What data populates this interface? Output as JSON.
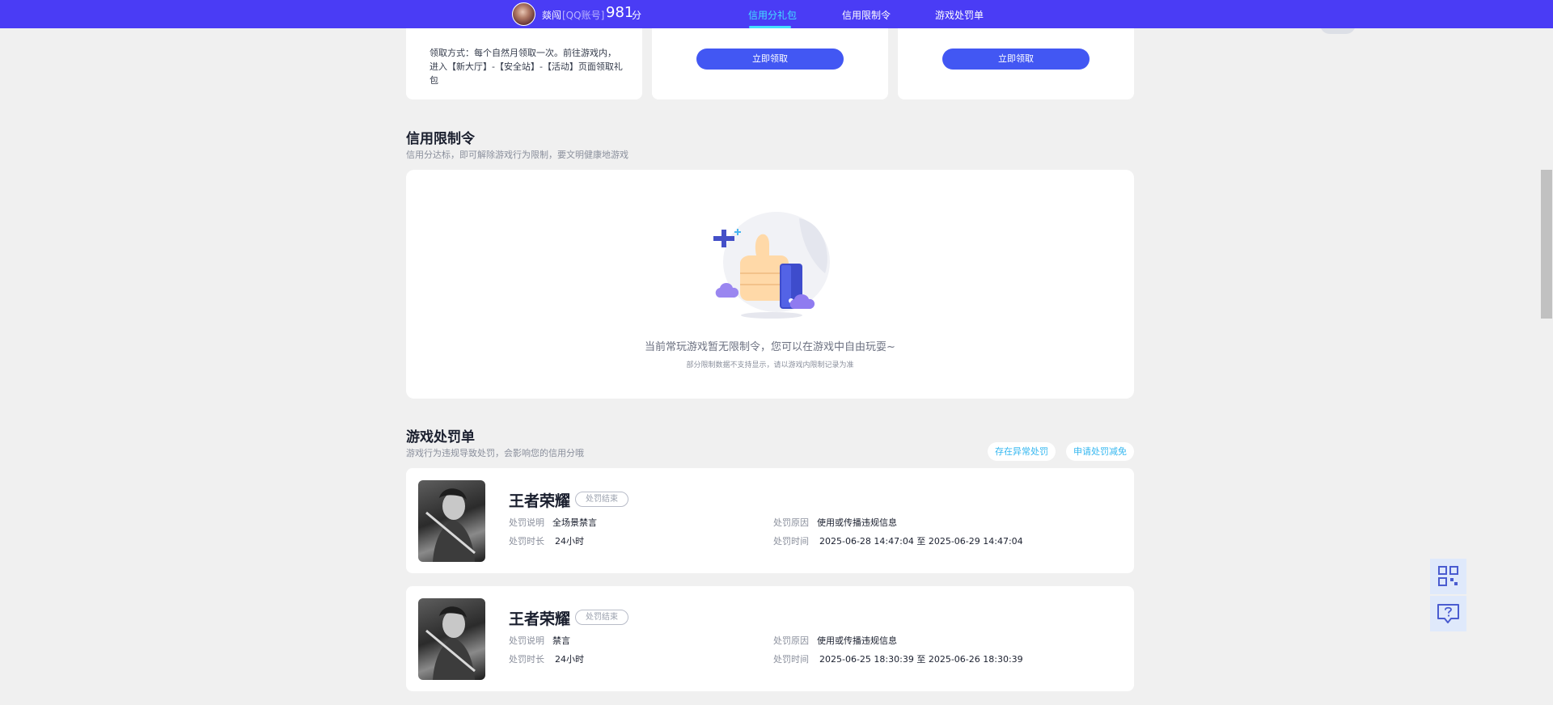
{
  "header": {
    "nickname": "燚闯",
    "account_type": "[QQ账号]",
    "credit_score": "981",
    "score_unit": "分",
    "tabs": [
      {
        "label": "信用分礼包",
        "active": true
      },
      {
        "label": "信用限制令",
        "active": false
      },
      {
        "label": "游戏处罚单",
        "active": false
      }
    ],
    "nav_color": "#4a3cf5",
    "active_tab_color": "#43e0ff"
  },
  "gift_section": {
    "card1_desc": "领取方式：每个自然月领取一次。前往游戏内，进入【新大厅】-【安全站】-【活动】页面领取礼包",
    "card2_button": "立即领取",
    "card3_button": "立即领取",
    "button_color": "#4257f3"
  },
  "restriction_section": {
    "title": "信用限制令",
    "subtitle": "信用分达标，即可解除游戏行为限制，要文明健康地游戏",
    "empty_text": "当前常玩游戏暂无限制令，您可以在游戏中自由玩耍~",
    "empty_note": "部分限制数据不支持显示，请以游戏内限制记录为准"
  },
  "punishment_section": {
    "title": "游戏处罚单",
    "subtitle": "游戏行为违规导致处罚，会影响您的信用分哦",
    "report_button": "存在异常处罚",
    "reduce_button": "申请处罚减免",
    "items": [
      {
        "game": "王者荣耀",
        "status": "处罚结束",
        "desc_label": "处罚说明",
        "desc": "全场景禁言",
        "reason_label": "处罚原因",
        "reason": "使用或传播违规信息",
        "duration_label": "处罚时长",
        "duration": "24小时",
        "time_label": "处罚时间",
        "time": "2025-06-28 14:47:04 至 2025-06-29 14:47:04"
      },
      {
        "game": "王者荣耀",
        "status": "处罚结束",
        "desc_label": "处罚说明",
        "desc": "禁言",
        "reason_label": "处罚原因",
        "reason": "使用或传播违规信息",
        "duration_label": "处罚时长",
        "duration": "24小时",
        "time_label": "处罚时间",
        "time": "2025-06-25 18:30:39 至 2025-06-26 18:30:39"
      }
    ]
  },
  "floating_tools": {
    "qr_icon": "qr-code-icon",
    "help_icon": "help-chat-icon"
  }
}
